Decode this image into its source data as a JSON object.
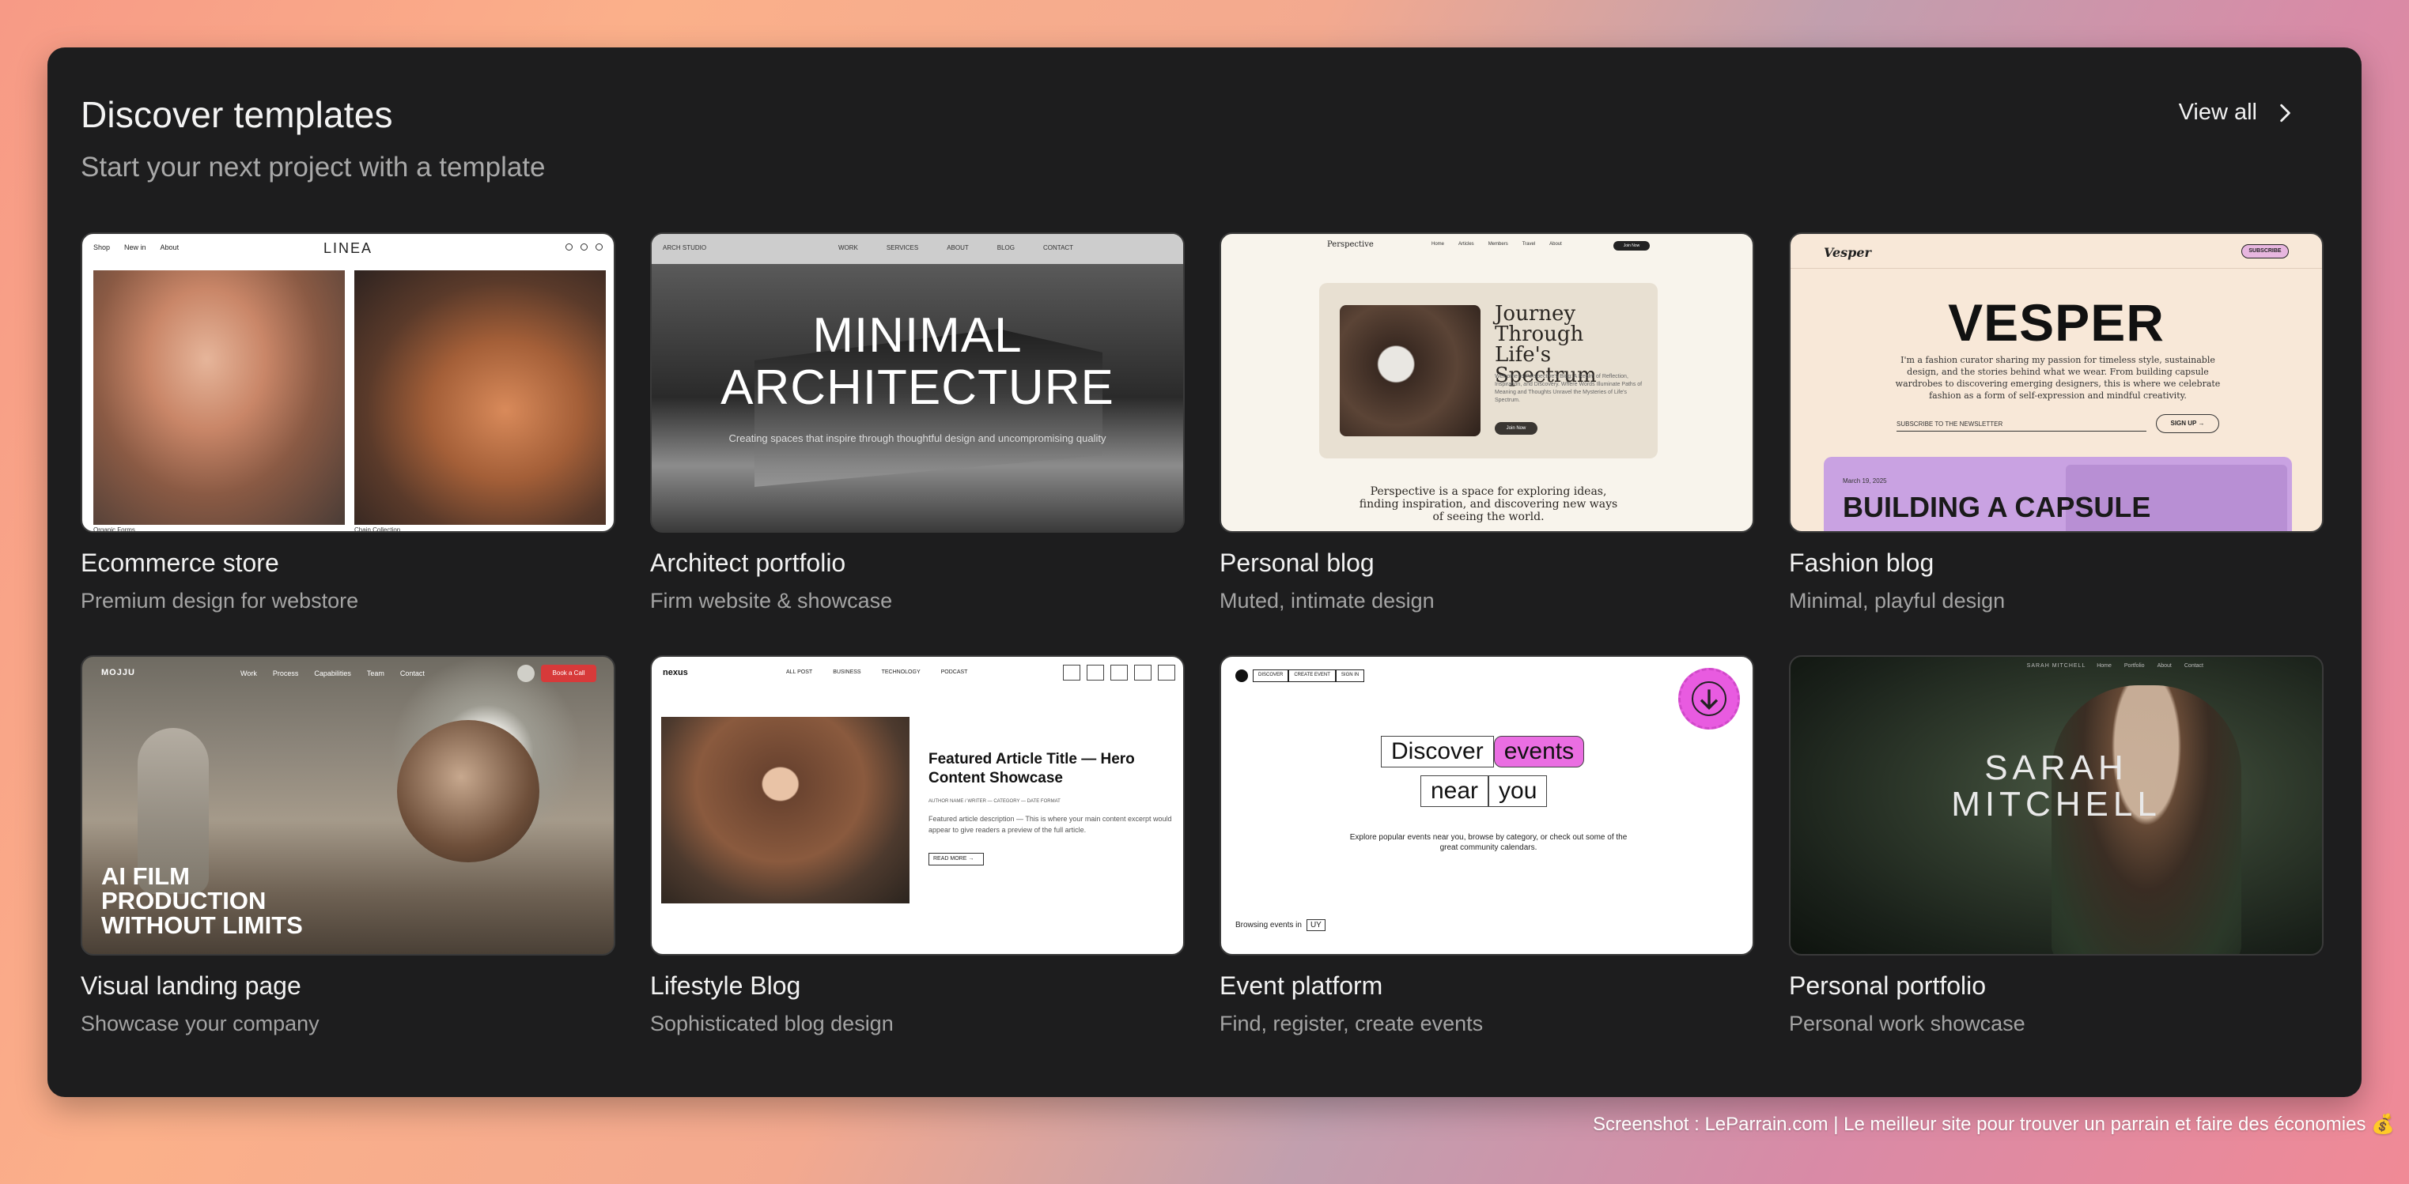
{
  "header": {
    "title": "Discover templates",
    "subtitle": "Start your next project with a template",
    "view_all_label": "View all"
  },
  "templates": [
    {
      "title": "Ecommerce store",
      "description": "Premium design for webstore",
      "preview": {
        "brand": "LINEA",
        "nav": [
          "Shop",
          "New in",
          "About"
        ],
        "caption_left": "Organic Forms",
        "caption_right": "Chain Collection"
      }
    },
    {
      "title": "Architect portfolio",
      "description": "Firm website & showcase",
      "preview": {
        "brand": "ARCH STUDIO",
        "nav": [
          "WORK",
          "SERVICES",
          "ABOUT",
          "BLOG",
          "CONTACT"
        ],
        "headline": "MINIMAL ARCHITECTURE",
        "tagline": "Creating spaces that inspire through thoughtful design and uncompromising quality"
      }
    },
    {
      "title": "Personal blog",
      "description": "Muted, intimate design",
      "preview": {
        "brand": "Perspective",
        "nav": [
          "Home",
          "Articles",
          "Members",
          "Travel",
          "About"
        ],
        "cta": "Join Now",
        "headline": "Journey Through Life's Spectrum",
        "intro": "Welcome to Perspective's Blog: A Realm of Reflection, Inspiration, and Discovery. Where Words Illuminate Paths of Meaning and Thoughts Unravel the Mysteries of Life's Spectrum.",
        "button": "Join Now",
        "quote": "Perspective is a space for exploring ideas, finding inspiration, and discovering new ways of seeing the world."
      }
    },
    {
      "title": "Fashion blog",
      "description": "Minimal, playful design",
      "preview": {
        "brand": "Vesper",
        "cta": "SUBSCRIBE",
        "headline": "VESPER",
        "intro": "I'm a fashion curator sharing my passion for timeless style, sustainable design, and the stories behind what we wear. From building capsule wardrobes to discovering emerging designers, this is where we celebrate fashion as a form of self-expression and mindful creativity.",
        "newsletter": "SUBSCRIBE TO THE NEWSLETTER",
        "signup": "SIGN UP →",
        "post_date": "March 19, 2025",
        "post_title": "BUILDING A CAPSULE"
      }
    },
    {
      "title": "Visual landing page",
      "description": "Showcase your company",
      "preview": {
        "brand": "MOJJU",
        "nav": [
          "Work",
          "Process",
          "Capabilities",
          "Team",
          "Contact"
        ],
        "cta": "Book a Call",
        "headline": "AI FILM PRODUCTION WITHOUT LIMITS"
      }
    },
    {
      "title": "Lifestyle Blog",
      "description": "Sophisticated blog design",
      "preview": {
        "brand": "nexus",
        "nav": [
          "ALL POST",
          "BUSINESS",
          "TECHNOLOGY",
          "PODCAST"
        ],
        "headline": "Featured Article Title — Hero Content Showcase",
        "meta": "AUTHOR NAME / WRITER   —   CATEGORY   —   DATE FORMAT",
        "excerpt": "Featured article description — This is where your main content excerpt would appear to give readers a preview of the full article.",
        "button": "READ MORE →"
      }
    },
    {
      "title": "Event platform",
      "description": "Find, register, create events",
      "preview": {
        "nav": [
          "DISCOVER",
          "CREATE EVENT",
          "SIGN IN"
        ],
        "words": [
          "Discover",
          "events",
          "near",
          "you"
        ],
        "intro": "Explore popular events near you, browse by category, or check out some of the great community calendars.",
        "browse_label": "Browsing events in",
        "browse_value": "UY"
      }
    },
    {
      "title": "Personal portfolio",
      "description": "Personal work showcase",
      "preview": {
        "brand": "SARAH MITCHELL",
        "nav": [
          "Home",
          "Portfolio",
          "About",
          "Contact"
        ],
        "headline": "SARAH MITCHELL"
      }
    }
  ],
  "footnote": "Screenshot : LeParrain.com | Le meilleur site pour trouver un parrain et faire des économies 💰"
}
